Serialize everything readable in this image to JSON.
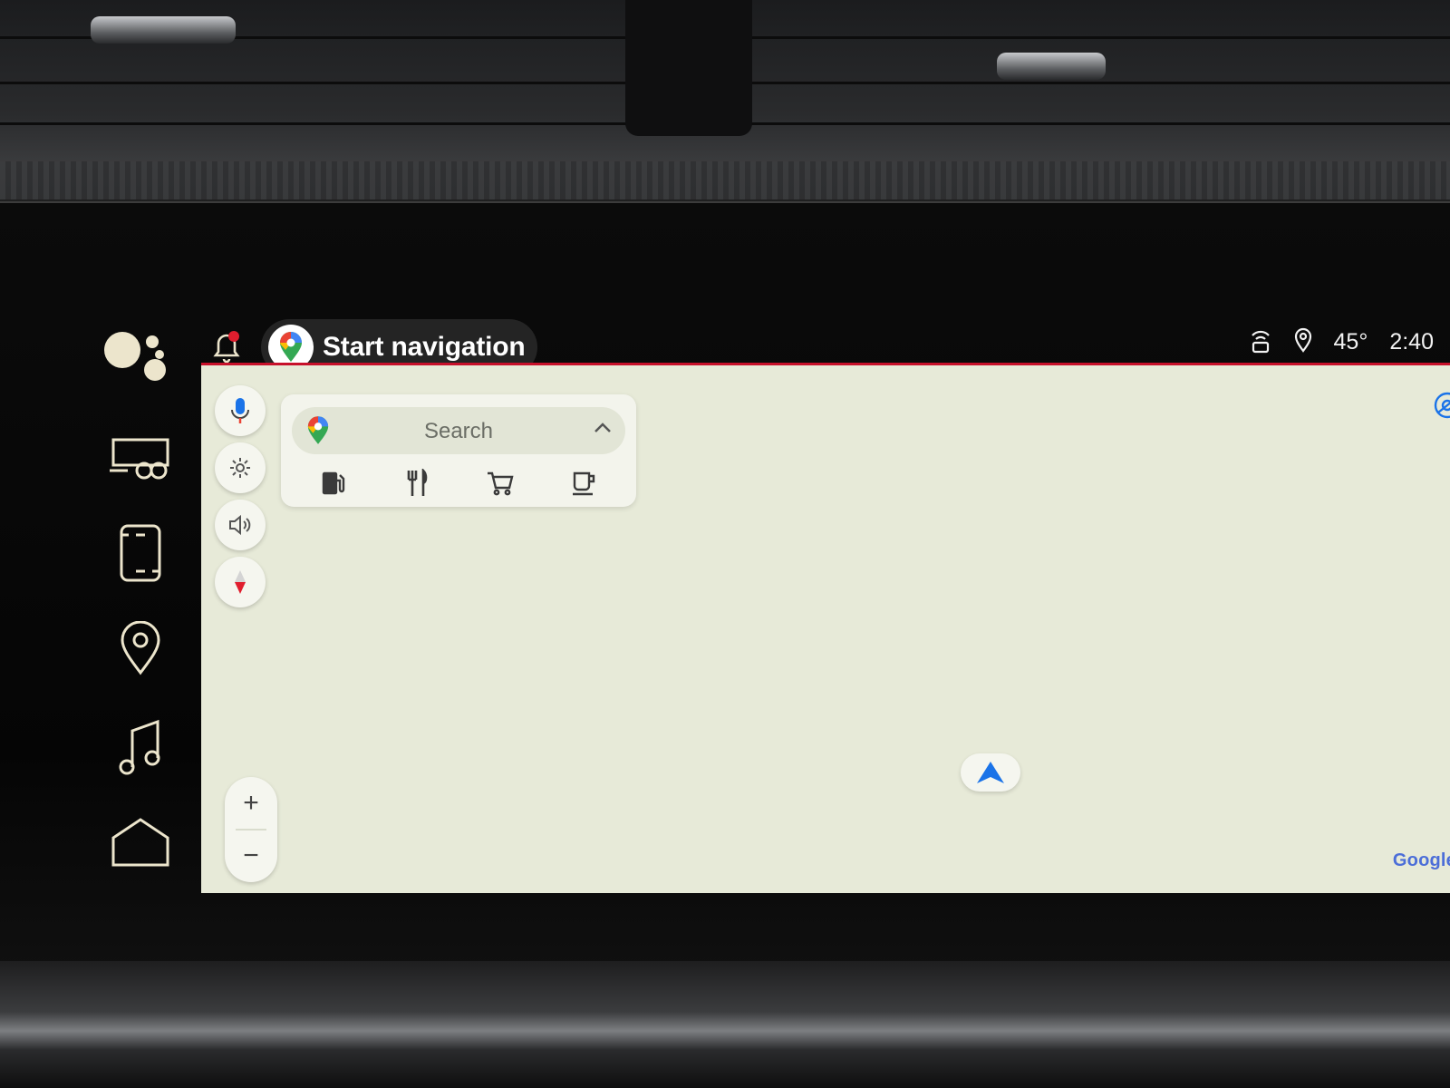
{
  "header": {
    "nav_pill_label": "Start navigation"
  },
  "status_bar": {
    "temperature": "45°",
    "time": "2:40"
  },
  "left_rail": {
    "items": [
      {
        "icon": "assistant-icon"
      },
      {
        "icon": "vehicle-trailer-icon"
      },
      {
        "icon": "phone-icon"
      },
      {
        "icon": "location-pin-icon"
      },
      {
        "icon": "music-note-icon"
      },
      {
        "icon": "home-icon"
      }
    ]
  },
  "map": {
    "search": {
      "placeholder": "Search"
    },
    "categories": [
      {
        "icon": "gas-station-icon"
      },
      {
        "icon": "restaurant-icon"
      },
      {
        "icon": "shopping-cart-icon"
      },
      {
        "icon": "coffee-icon"
      }
    ],
    "side_buttons": [
      {
        "icon": "microphone-icon"
      },
      {
        "icon": "settings-icon"
      },
      {
        "icon": "volume-icon"
      },
      {
        "icon": "compass-icon"
      }
    ],
    "zoom": {
      "in_label": "+",
      "out_label": "−"
    },
    "attribution": "Google"
  },
  "colors": {
    "accent_red": "#c7102a",
    "map_background": "#e7ead8",
    "rail_icon": "#ece5cc",
    "nav_blue": "#1a73e8"
  }
}
